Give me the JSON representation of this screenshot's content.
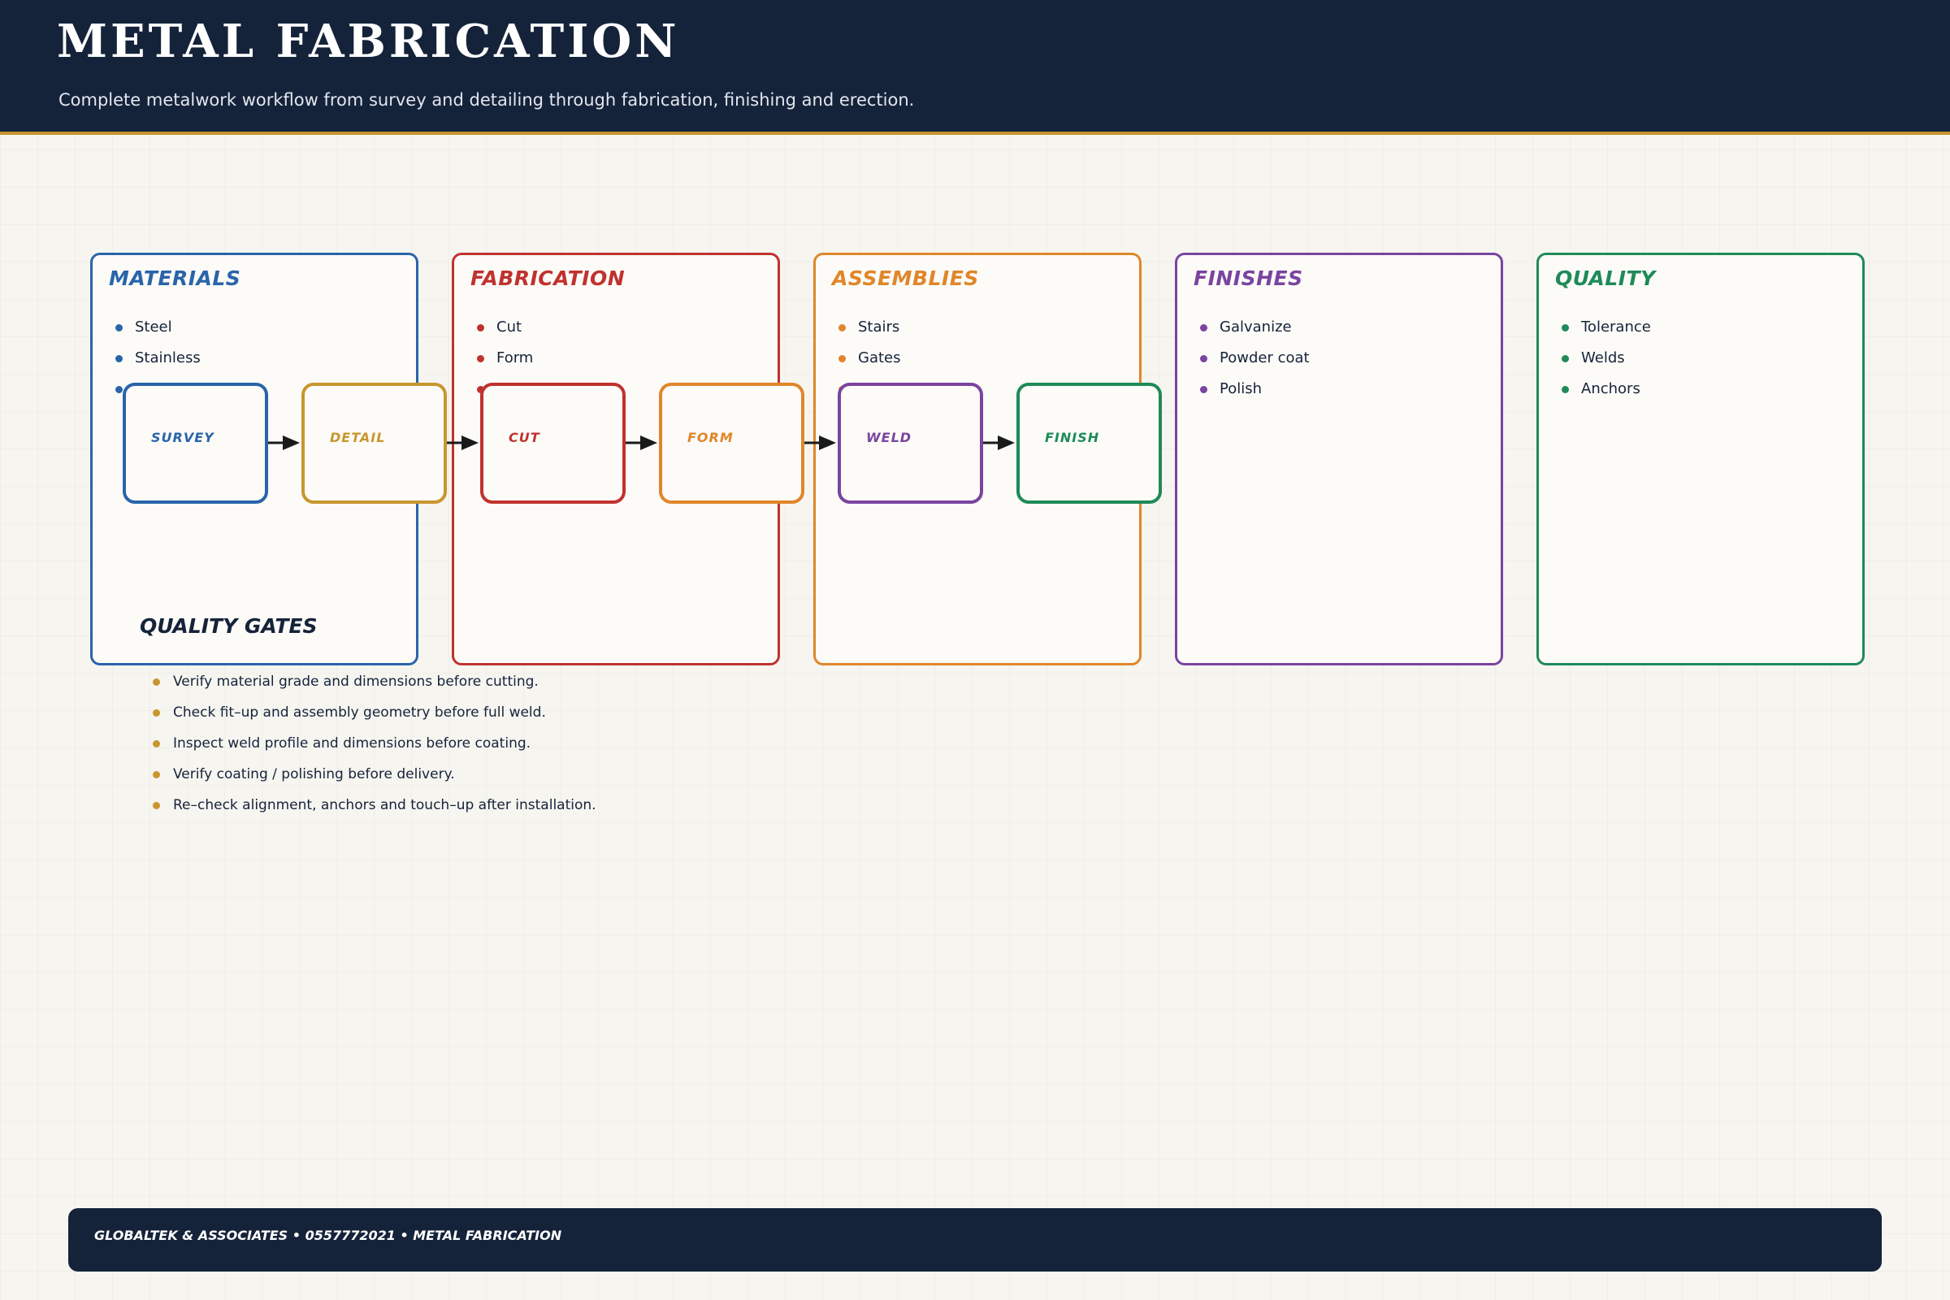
{
  "header": {
    "title": "METAL FABRICATION",
    "subtitle": "Complete metalwork workflow from survey and detailing through fabrication, finishing and erection."
  },
  "panels": [
    {
      "title": "MATERIALS",
      "color": "#2a64aa",
      "items": [
        "Steel",
        "Stainless",
        ""
      ]
    },
    {
      "title": "FABRICATION",
      "color": "#c0322f",
      "items": [
        "Cut",
        "Form",
        ""
      ]
    },
    {
      "title": "ASSEMBLIES",
      "color": "#e0862a",
      "items": [
        "Stairs",
        "Gates",
        ""
      ]
    },
    {
      "title": "FINISHES",
      "color": "#7a44a0",
      "items": [
        "Galvanize",
        "Powder coat",
        "Polish"
      ]
    },
    {
      "title": "QUALITY",
      "color": "#1f8a58",
      "items": [
        "Tolerance",
        "Welds",
        "Anchors"
      ]
    }
  ],
  "steps": [
    {
      "label": "SURVEY",
      "color": "#2a64aa"
    },
    {
      "label": "DETAIL",
      "color": "#c8962e"
    },
    {
      "label": "CUT",
      "color": "#c0322f"
    },
    {
      "label": "FORM",
      "color": "#e0862a"
    },
    {
      "label": "WELD",
      "color": "#7a44a0"
    },
    {
      "label": "FINISH",
      "color": "#1f8a58"
    }
  ],
  "quality_gates": {
    "title": "QUALITY GATES",
    "items": [
      "Verify material grade and dimensions before cutting.",
      "Check fit–up and assembly geometry before full weld.",
      "Inspect weld profile and dimensions before coating.",
      "Verify coating / polishing before delivery.",
      "Re–check alignment, anchors and touch–up after installation."
    ]
  },
  "footer": {
    "text": "GLOBALTEK & ASSOCIATES • 0557772021 • METAL FABRICATION"
  },
  "colors": {
    "navy": "#15233a",
    "gold": "#c8962e",
    "background": "#f6f5f0",
    "arrow": "#1a1a1a"
  }
}
